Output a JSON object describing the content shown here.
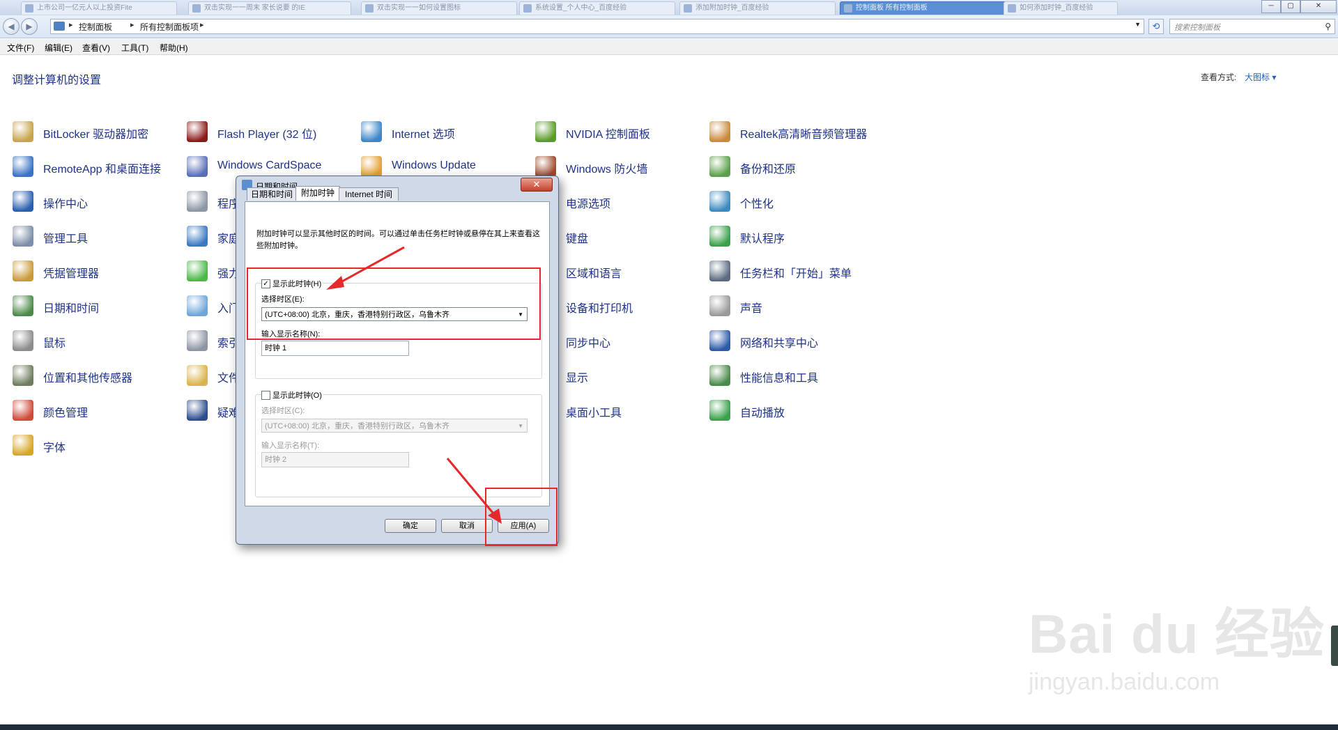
{
  "tabs": [
    {
      "label": "上市公司一亿元人以上投资Fite"
    },
    {
      "label": "双击实现一一周末 家长说要 的IE"
    },
    {
      "label": "双击实现一一如何设置图标"
    },
    {
      "label": "系统设置_个人中心_百度经验"
    },
    {
      "label": "添加附加时钟_百度经验"
    },
    {
      "label": "控制面板 所有控制面板"
    },
    {
      "label": "如何添加时钟_百度经验"
    }
  ],
  "window_buttons": {
    "minimize": "─",
    "restore": "▢",
    "close": "✕"
  },
  "address": {
    "crumbs": [
      "控制面板",
      "所有控制面板项"
    ],
    "separator": "▸"
  },
  "search": {
    "placeholder": "搜索控制面板"
  },
  "menu": [
    "文件(F)",
    "编辑(E)",
    "查看(V)",
    "工具(T)",
    "帮助(H)"
  ],
  "page_title": "调整计算机的设置",
  "view_by": {
    "label": "查看方式:",
    "value": "大图标 ▾"
  },
  "items": [
    {
      "label": "BitLocker 驱动器加密",
      "color": "#c8a44a"
    },
    {
      "label": "RemoteApp 和桌面连接",
      "color": "#3b73c4"
    },
    {
      "label": "操作中心",
      "color": "#2a5fb0"
    },
    {
      "label": "管理工具",
      "color": "#7d8ea8"
    },
    {
      "label": "凭据管理器",
      "color": "#c99a3a"
    },
    {
      "label": "日期和时间",
      "color": "#4d8a4a"
    },
    {
      "label": "鼠标",
      "color": "#8c8c8c"
    },
    {
      "label": "位置和其他传感器",
      "color": "#6f7d5e"
    },
    {
      "label": "颜色管理",
      "color": "#d04a3a"
    },
    {
      "label": "字体",
      "color": "#d8a627"
    },
    {
      "label": "Flash Player (32 位)",
      "color": "#8b1a1a"
    },
    {
      "label": "Windows CardSpace",
      "color": "#5a6fb8"
    },
    {
      "label": "程序",
      "color": "#8c96a5"
    },
    {
      "label": "家庭",
      "color": "#3a78c2"
    },
    {
      "label": "强力",
      "color": "#4bb84a"
    },
    {
      "label": "入门",
      "color": "#6fa6d8"
    },
    {
      "label": "索引",
      "color": "#8d95a5"
    },
    {
      "label": "文件",
      "color": "#d9b44a"
    },
    {
      "label": "疑难",
      "color": "#2c4d8c"
    },
    {
      "label": "Internet 选项",
      "color": "#3b86c8"
    },
    {
      "label": "Windows Update",
      "color": "#e0a030"
    },
    {
      "label": "NVIDIA 控制面板",
      "color": "#5a9a2a"
    },
    {
      "label": "Windows 防火墙",
      "color": "#9c4a2a"
    },
    {
      "label": "电源选项",
      "color": "#4a88c0"
    },
    {
      "label": "键盘",
      "color": "#888888"
    },
    {
      "label": "区域和语言",
      "color": "#3a8ac8"
    },
    {
      "label": "设备和打印机",
      "color": "#7a7a7a"
    },
    {
      "label": "同步中心",
      "color": "#3aa04a"
    },
    {
      "label": "显示",
      "color": "#4a7ac0"
    },
    {
      "label": "桌面小工具",
      "color": "#5a8ad0"
    },
    {
      "label": "Realtek高清晰音频管理器",
      "color": "#c98a3a"
    },
    {
      "label": "备份和还原",
      "color": "#5aa04a"
    },
    {
      "label": "个性化",
      "color": "#3a8ac0"
    },
    {
      "label": "默认程序",
      "color": "#3aa04a"
    },
    {
      "label": "任务栏和「开始」菜单",
      "color": "#5a6a80"
    },
    {
      "label": "声音",
      "color": "#9a9a9a"
    },
    {
      "label": "网络和共享中心",
      "color": "#2a5aa8"
    },
    {
      "label": "性能信息和工具",
      "color": "#4a8a4a"
    },
    {
      "label": "自动播放",
      "color": "#3aa04a"
    }
  ],
  "dialog": {
    "title": "日期和时间",
    "close": "✕",
    "tabs": [
      "日期和时间",
      "附加时钟",
      "Internet 时间"
    ],
    "description": "附加时钟可以显示其他时区的时间。可以通过单击任务栏时钟或悬停在其上来查看这些附加时钟。",
    "clock1": {
      "check_label": "显示此时钟(H)",
      "checked": true,
      "tz_label": "选择时区(E):",
      "tz_value": "(UTC+08:00) 北京，重庆，香港特别行政区，乌鲁木齐",
      "name_label": "输入显示名称(N):",
      "name_value": "时钟 1"
    },
    "clock2": {
      "check_label": "显示此时钟(O)",
      "checked": false,
      "tz_label": "选择时区(C):",
      "tz_value": "(UTC+08:00) 北京，重庆，香港特别行政区，乌鲁木齐",
      "name_label": "输入显示名称(T):",
      "name_value": "时钟 2"
    },
    "buttons": {
      "ok": "确定",
      "cancel": "取消",
      "apply": "应用(A)"
    }
  },
  "watermark": {
    "line1": "Bai du 经验",
    "line2": "jingyan.baidu.com"
  },
  "colors": {
    "link": "#1e3287",
    "annotation": "#e8272a",
    "dialog_frame": "#cfd9e8"
  }
}
